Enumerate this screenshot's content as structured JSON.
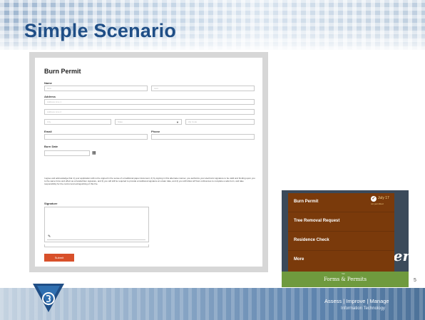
{
  "slide": {
    "title": "Simple Scenario",
    "page_number": "5"
  },
  "form": {
    "title": "Burn Permit",
    "name_label": "Name",
    "first_placeholder": "First",
    "last_placeholder": "Last",
    "address_label": "Address",
    "address1_placeholder": "Address Line 1",
    "address2_placeholder": "Address Line 2",
    "city_placeholder": "City",
    "state_placeholder": "State",
    "zip_placeholder": "Zip Code",
    "email_label": "Email",
    "phone_label": "Phone",
    "burn_date_label": "Burn Date",
    "agreement_text": "I agree and acknowledge that 1) your application will not be signed in the sense of a traditional paper document, 2) by signing in this alternate manner, you authorize your electronic signature to be valid and binding upon you to the same force and effect as a handwritten signature, and 3) you will still be required to provide a traditional signature at a later date, and 4) you will follow all Town ordinances to complete a safe burn, and take responsibility for the control and extinguishing of this fire.",
    "signature_label": "Signature",
    "submit_label": "Submit"
  },
  "menu": {
    "items": [
      {
        "label": "Burn Permit"
      },
      {
        "label": "Tree Removal Request"
      },
      {
        "label": "Residence Check"
      },
      {
        "label": "More"
      }
    ],
    "date": "July 17",
    "date_sub": "not permitted",
    "background_text": "ver",
    "footer_tab": "Tab",
    "footer_label": "Forms & Permits"
  },
  "footer": {
    "tagline": "Assess | Improve | Manage",
    "subtag": "Information Technology"
  },
  "colors": {
    "title": "#1f4e86",
    "submit": "#d8502a",
    "menu_panel": "#7a3a0b",
    "menu_footer": "#6f9a3e"
  }
}
